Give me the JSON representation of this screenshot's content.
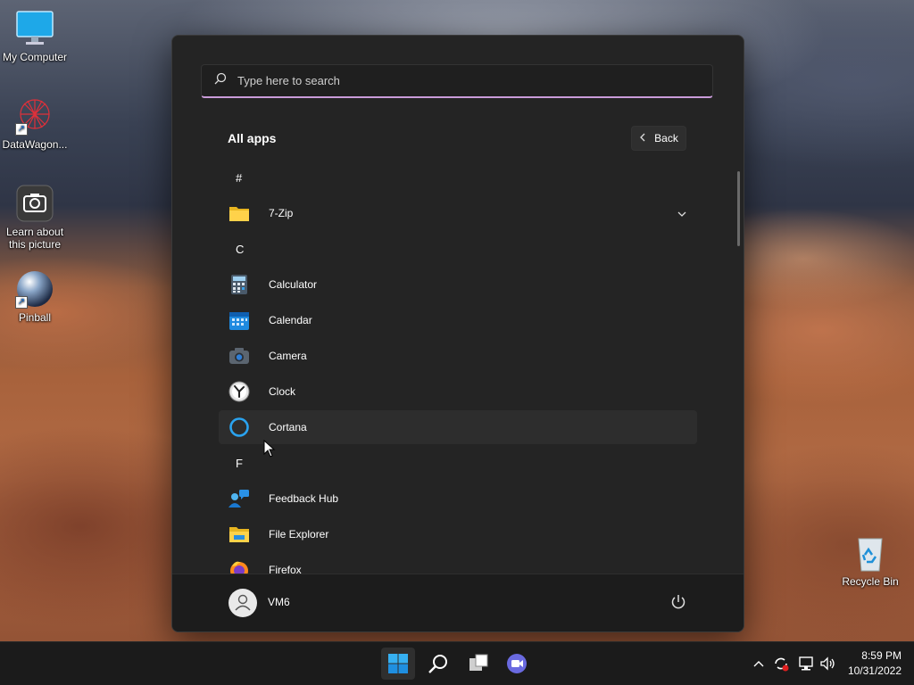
{
  "desktop": {
    "icons": [
      {
        "label": "My Computer",
        "icon": "monitor-icon"
      },
      {
        "label": "DataWagon...",
        "icon": "datawagon-icon"
      },
      {
        "label": "Learn about this picture",
        "icon": "camera-icon"
      },
      {
        "label": "Pinball",
        "icon": "pinball-icon"
      },
      {
        "label": "Recycle Bin",
        "icon": "recycle-bin-icon"
      }
    ]
  },
  "start_menu": {
    "search": {
      "placeholder": "Type here to search",
      "value": ""
    },
    "section_title": "All apps",
    "back_label": "Back",
    "list": [
      {
        "type": "letter",
        "label": "#"
      },
      {
        "type": "app",
        "label": "7-Zip",
        "icon": "folder-icon",
        "expandable": true
      },
      {
        "type": "letter",
        "label": "C"
      },
      {
        "type": "app",
        "label": "Calculator",
        "icon": "calculator-icon"
      },
      {
        "type": "app",
        "label": "Calendar",
        "icon": "calendar-icon"
      },
      {
        "type": "app",
        "label": "Camera",
        "icon": "camera-app-icon"
      },
      {
        "type": "app",
        "label": "Clock",
        "icon": "clock-icon"
      },
      {
        "type": "app",
        "label": "Cortana",
        "icon": "cortana-icon",
        "hovered": true
      },
      {
        "type": "letter",
        "label": "F"
      },
      {
        "type": "app",
        "label": "Feedback Hub",
        "icon": "feedback-hub-icon"
      },
      {
        "type": "app",
        "label": "File Explorer",
        "icon": "file-explorer-icon"
      },
      {
        "type": "app",
        "label": "Firefox",
        "icon": "firefox-icon"
      }
    ],
    "user": {
      "name": "VM6"
    }
  },
  "taskbar": {
    "buttons": [
      "start-icon",
      "search-icon",
      "task-view-icon",
      "chat-icon"
    ],
    "tray": [
      "chevron-up-icon",
      "sync-icon",
      "network-icon",
      "volume-icon"
    ],
    "time": "8:59 PM",
    "date": "10/31/2022"
  },
  "colors": {
    "accent": "#c99bd9",
    "menu_bg": "#242424",
    "hover_bg": "#2d2d2d"
  }
}
